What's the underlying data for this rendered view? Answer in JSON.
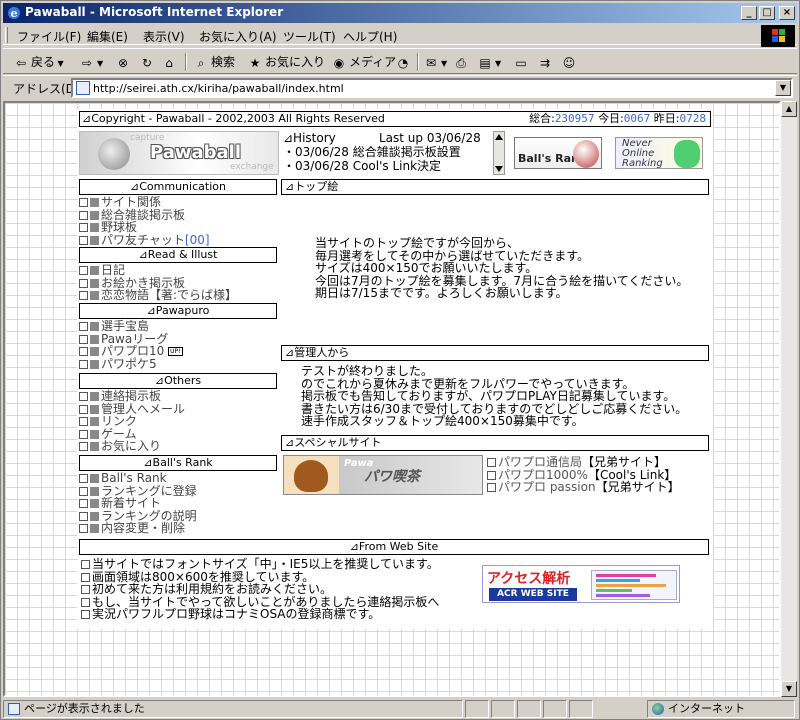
{
  "window": {
    "title": "Pawaball - Microsoft Internet Explorer",
    "buttons": {
      "minimize": "_",
      "maximize": "□",
      "close": "×"
    }
  },
  "menu": [
    "ファイル(F)",
    "編集(E)",
    "表示(V)",
    "お気に入り(A)",
    "ツール(T)",
    "ヘルプ(H)"
  ],
  "toolbar": {
    "back": "戻る",
    "search": "検索",
    "favorites": "お気に入り",
    "media": "メディア"
  },
  "address": {
    "label": "アドレス(D)",
    "url": "http://seirei.ath.cx/kiriha/pawaball/index.html"
  },
  "header": {
    "copyright": "⊿Copyright - Pawaball - 2002,2003  All Rights Reserved",
    "total_label": "総合:",
    "total": "230957",
    "today_label": "今日:",
    "today": "0067",
    "yesterday_label": "昨日:",
    "yesterday": "0728"
  },
  "logo": {
    "text": "Pawaball",
    "top": "capture",
    "bottom": "exchange"
  },
  "history": {
    "title": "⊿History",
    "lastup": "Last up 03/06/28",
    "items": [
      "・03/06/28  総合雑談掲示板設置",
      "・03/06/28  Cool's Link決定"
    ]
  },
  "banners": {
    "balls_rank": "Ball's Rank",
    "never_online_1": "Never",
    "never_online_2": "Online",
    "never_online_3": "Ranking"
  },
  "nav": {
    "communication": {
      "title": "⊿Communication",
      "items": [
        "サイト関係",
        "総合雑談掲示板",
        "野球板",
        "パワ友チャット"
      ],
      "chat_count": "[00]"
    },
    "read_illust": {
      "title": "⊿Read & Illust",
      "items": [
        "日記",
        "お絵かき掲示板",
        "恋恋物語【著:でらば様】"
      ]
    },
    "pawapuro": {
      "title": "⊿Pawapuro",
      "items": [
        "選手宝島",
        "Pawaリーグ",
        "パワプロ10",
        "パワポケ5"
      ],
      "badge": "UP!"
    },
    "others": {
      "title": "⊿Others",
      "items": [
        "連絡掲示板",
        "管理人へメール",
        "リンク",
        "ゲーム",
        "お気に入り"
      ]
    },
    "balls_rank": {
      "title": "⊿Ball's Rank",
      "items": [
        "Ball's Rank",
        "ランキングに登録",
        "新着サイト",
        "ランキングの説明",
        "内容変更・削除"
      ]
    }
  },
  "top_art": {
    "title": "⊿トップ絵",
    "lines": [
      "当サイトのトップ絵ですが今回から、",
      "毎月選考をしてその中から選ばせていただきます。",
      "サイズは400×150でお願いいたします。",
      "今回は7月のトップ絵を募集します。7月に合う絵を描いてください。",
      "期日は7/15までです。よろしくお願いします。"
    ]
  },
  "admin": {
    "title": "⊿管理人から",
    "lines": [
      "テストが終わりました。",
      "のでこれから夏休みまで更新をフルパワーでやっていきます。",
      "掲示板でも告知しておりますが、パワプロPLAY日記募集しています。",
      "書きたい方は6/30まで受付しておりますのでどしどしご応募ください。",
      "速手作成スタッフ＆トップ絵400×150募集中です。"
    ]
  },
  "special": {
    "title": "⊿スペシャルサイト",
    "banner_top": "Pawa",
    "banner_text": "パワ喫茶",
    "sites": [
      {
        "name": "パワプロ通信局",
        "tag": "【兄弟サイト】"
      },
      {
        "name": "パワプロ1000%",
        "tag": "【Cool's Link】"
      },
      {
        "name": "パワプロ passion",
        "tag": "【兄弟サイト】"
      }
    ]
  },
  "from_site": {
    "title": "⊿From Web Site",
    "lines": [
      "当サイトではフォントサイズ「中」・IE5以上を推奨しています。",
      "画面領域は800×600を推奨しています。",
      "初めて来た方は利用規約をお読みください。",
      "もし、当サイトでやって欲しいことがありましたら連絡掲示板へ",
      "実況パワフルプロ野球はコナミOSAの登録商標です。"
    ]
  },
  "acr": {
    "title": "アクセス解析",
    "sub": "ACR WEB SITE"
  },
  "status": {
    "text": "ページが表示されました",
    "zone": "インターネット"
  }
}
